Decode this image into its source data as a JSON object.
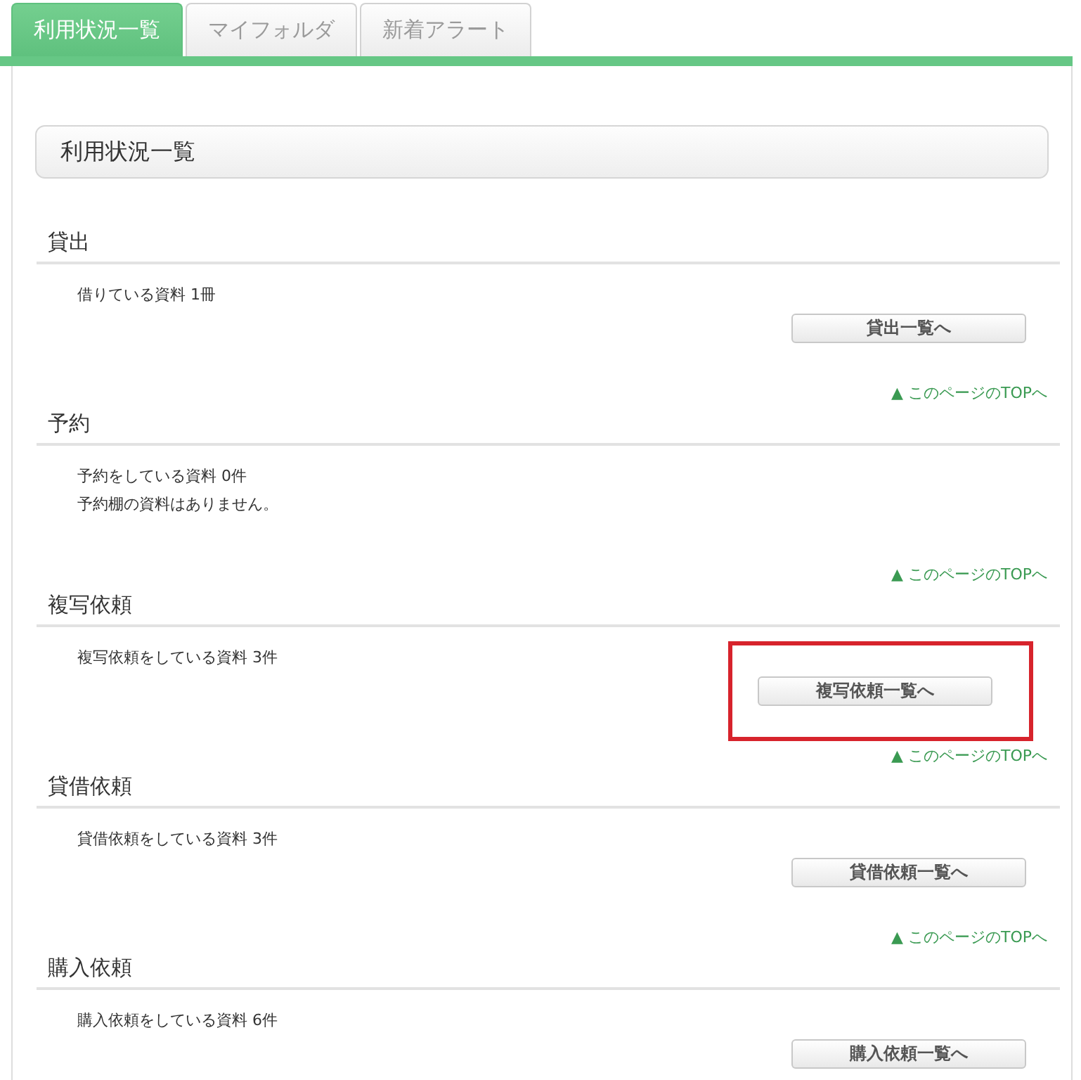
{
  "tabs": [
    {
      "label": "利用状況一覧",
      "selected": true
    },
    {
      "label": "マイフォルダ",
      "selected": false
    },
    {
      "label": "新着アラート",
      "selected": false
    }
  ],
  "page_title": "利用状況一覧",
  "sections": [
    {
      "title": "貸出",
      "lines": [
        "借りている資料 1冊"
      ],
      "button": "貸出一覧へ",
      "highlighted": false,
      "top_link": "▲ このページのTOPへ"
    },
    {
      "title": "予約",
      "lines": [
        "予約をしている資料 0件",
        "予約棚の資料はありません。"
      ],
      "highlighted": false,
      "top_link": "▲ このページのTOPへ"
    },
    {
      "title": "複写依頼",
      "lines": [
        "複写依頼をしている資料 3件"
      ],
      "button": "複写依頼一覧へ",
      "highlighted": true,
      "top_link": "▲ このページのTOPへ"
    },
    {
      "title": "貸借依頼",
      "lines": [
        "貸借依頼をしている資料 3件"
      ],
      "button": "貸借依頼一覧へ",
      "highlighted": false,
      "top_link": "▲ このページのTOPへ"
    },
    {
      "title": "購入依頼",
      "lines": [
        "購入依頼をしている資料 6件"
      ],
      "button": "購入依頼一覧へ",
      "highlighted": false
    }
  ]
}
